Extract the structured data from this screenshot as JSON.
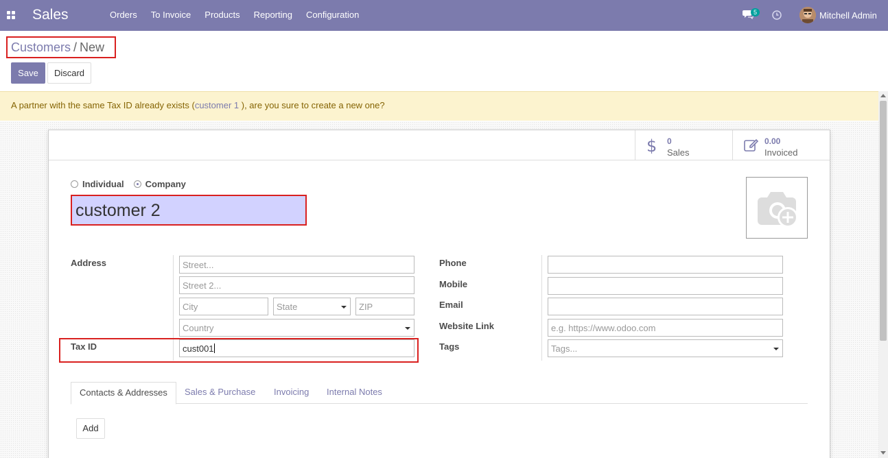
{
  "navbar": {
    "app_name": "Sales",
    "menu": [
      "Orders",
      "To Invoice",
      "Products",
      "Reporting",
      "Configuration"
    ],
    "chat_count": "5",
    "user_name": "Mitchell Admin",
    "bg_color": "#7c7bad"
  },
  "breadcrumb": {
    "parent": "Customers",
    "separator": "/",
    "current": "New"
  },
  "buttons": {
    "save": "Save",
    "discard": "Discard"
  },
  "alert": {
    "before": "A partner with the same Tax ID already exists (",
    "link": "customer 1",
    "after": " ), are you sure to create a new one?"
  },
  "stats": {
    "sales_value": "0",
    "sales_label": "Sales",
    "invoiced_value": "0.00",
    "invoiced_label": "Invoiced"
  },
  "company_type": {
    "individual": "Individual",
    "company": "Company",
    "selected": "Company"
  },
  "partner_name": "customer 2",
  "labels": {
    "address": "Address",
    "tax_id": "Tax ID",
    "phone": "Phone",
    "mobile": "Mobile",
    "email": "Email",
    "website": "Website Link",
    "tags": "Tags"
  },
  "placeholders": {
    "street": "Street...",
    "street2": "Street 2...",
    "city": "City",
    "state": "State",
    "zip": "ZIP",
    "country": "Country",
    "website": "e.g. https://www.odoo.com",
    "tags": "Tags..."
  },
  "values": {
    "tax_id": "cust001",
    "phone": "",
    "mobile": "",
    "email": ""
  },
  "tabs": [
    "Contacts & Addresses",
    "Sales & Purchase",
    "Invoicing",
    "Internal Notes"
  ],
  "active_tab": "Contacts & Addresses",
  "add_button": "Add"
}
